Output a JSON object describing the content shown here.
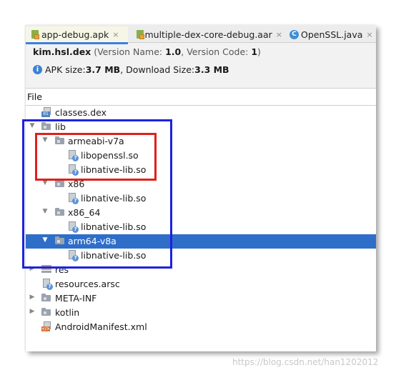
{
  "tabs": [
    {
      "label": "app-debug.apk",
      "icon": "apk-file-icon",
      "active": true
    },
    {
      "label": "multiple-dex-core-debug.aar",
      "icon": "aar-file-icon",
      "active": false
    },
    {
      "label": "OpenSSL.java",
      "icon": "java-class-icon",
      "active": false
    }
  ],
  "close_glyph": "×",
  "header": {
    "package_name": "kim.hsl.dex",
    "version_name_label": "(Version Name: ",
    "version_name": "1.0",
    "version_code_label": ", Version Code: ",
    "version_code": "1",
    "version_close": ")"
  },
  "size_info": {
    "apk_size_label": "APK size: ",
    "apk_size": "3.7 MB",
    "download_size_label": ", Download Size: ",
    "download_size": "3.3 MB"
  },
  "column_header": "File",
  "tree": [
    {
      "label": "classes.dex",
      "level": 1,
      "type": "dex",
      "arrow": ""
    },
    {
      "label": "lib",
      "level": 0,
      "type": "folder",
      "arrow": "▼"
    },
    {
      "label": "armeabi-v7a",
      "level": 1,
      "type": "folder",
      "arrow": "▼"
    },
    {
      "label": "libopenssl.so",
      "level": 2,
      "type": "file",
      "arrow": ""
    },
    {
      "label": "libnative-lib.so",
      "level": 2,
      "type": "file",
      "arrow": ""
    },
    {
      "label": "x86",
      "level": 1,
      "type": "folder",
      "arrow": "▼"
    },
    {
      "label": "libnative-lib.so",
      "level": 2,
      "type": "file",
      "arrow": ""
    },
    {
      "label": "x86_64",
      "level": 1,
      "type": "folder",
      "arrow": "▼"
    },
    {
      "label": "libnative-lib.so",
      "level": 2,
      "type": "file",
      "arrow": ""
    },
    {
      "label": "arm64-v8a",
      "level": 1,
      "type": "folder",
      "arrow": "▼",
      "selected": true
    },
    {
      "label": "libnative-lib.so",
      "level": 2,
      "type": "file",
      "arrow": ""
    },
    {
      "label": "res",
      "level": 0,
      "type": "res",
      "arrow": "▶"
    },
    {
      "label": "resources.arsc",
      "level": 0,
      "type": "file",
      "arrow": ""
    },
    {
      "label": "META-INF",
      "level": 0,
      "type": "folder",
      "arrow": "▶"
    },
    {
      "label": "kotlin",
      "level": 0,
      "type": "folder",
      "arrow": "▶"
    },
    {
      "label": "AndroidManifest.xml",
      "level": 0,
      "type": "xml",
      "arrow": ""
    }
  ],
  "watermark": "https://blog.csdn.net/han1202012",
  "colors": {
    "selection": "#2e6ec9",
    "annotation_red": "#e0201b",
    "annotation_blue": "#1c22e0",
    "active_tab_underline": "#3d7fe0"
  }
}
